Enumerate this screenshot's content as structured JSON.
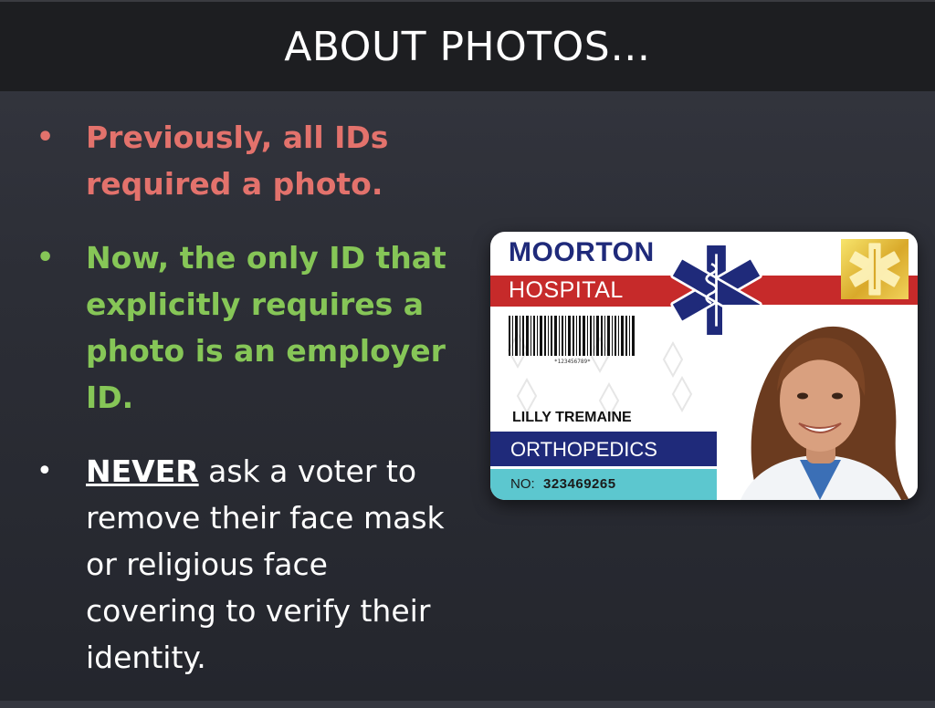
{
  "slide": {
    "title": "ABOUT PHOTOS…",
    "bullets": [
      {
        "marker": "•",
        "text": "Previously, all IDs required a photo."
      },
      {
        "marker": "•",
        "text": "Now, the only ID that explicitly requires a photo is an employer ID."
      },
      {
        "marker": "•",
        "emphasis": "NEVER",
        "text": " ask a voter to remove their face mask or religious face covering to verify their identity."
      }
    ]
  },
  "id_card": {
    "org_name": "MOORTON",
    "org_sub": "HOSPITAL",
    "barcode_number": "*123456789*",
    "holder_name": "LILLY TREMAINE",
    "department": "ORTHOPEDICS",
    "number_label": "NO:",
    "number_value": "323469265",
    "icons": [
      "star-of-life-icon",
      "gold-seal-icon",
      "barcode",
      "employee-photo"
    ]
  },
  "colors": {
    "background": "#2f3139",
    "title_bar": "#1d1e21",
    "bullet_previous": "#e3726c",
    "bullet_now": "#86c657",
    "bullet_never": "#ffffff",
    "card_navy": "#1f2a7a",
    "card_red": "#c62a2a",
    "card_teal": "#5cc7cf",
    "card_gold": "#e2b83a"
  }
}
